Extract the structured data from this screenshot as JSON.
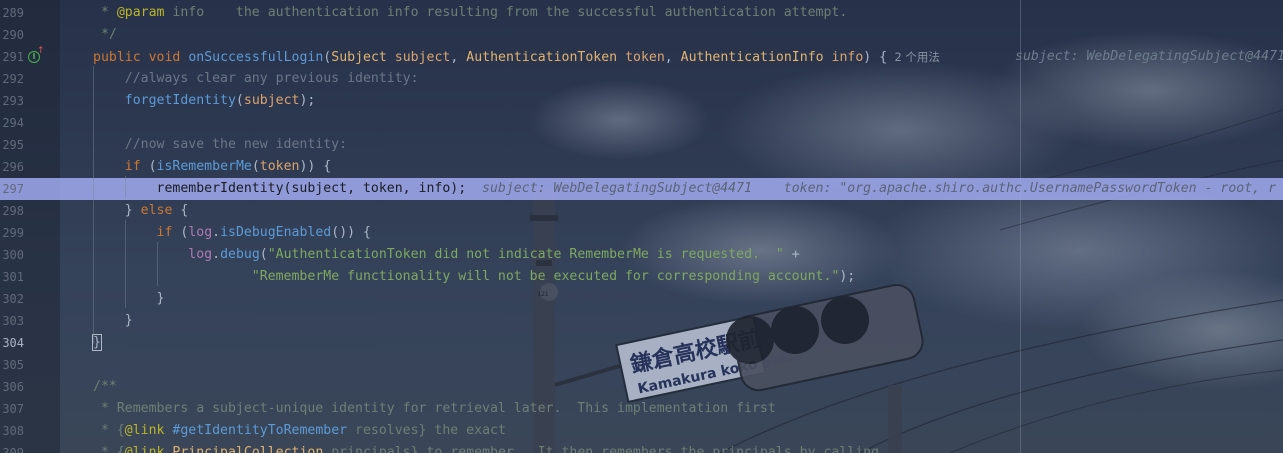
{
  "editor": {
    "usages_hint": "2 个用法",
    "header_inlay": "subject: WebDelegatingSubject@4471",
    "current_line": "304",
    "lines": [
      {
        "num": "289",
        "tokens": [
          {
            "t": " * ",
            "c": "t-doc"
          },
          {
            "t": "@param",
            "c": "t-ann"
          },
          {
            "t": " info",
            "c": "t-doc"
          },
          {
            "t": "    the authentication info resulting from the successful authentication attempt.",
            "c": "t-doc"
          }
        ]
      },
      {
        "num": "290",
        "tokens": [
          {
            "t": " */",
            "c": "t-doc"
          }
        ]
      },
      {
        "num": "291",
        "tokens": [
          {
            "t": "public",
            "c": "t-kw"
          },
          {
            "t": " ",
            "c": "t-plain"
          },
          {
            "t": "void",
            "c": "t-kw"
          },
          {
            "t": " ",
            "c": "t-plain"
          },
          {
            "t": "onSuccessfulLogin",
            "c": "t-fncall"
          },
          {
            "t": "(",
            "c": "t-plain"
          },
          {
            "t": "Subject",
            "c": "t-cls"
          },
          {
            "t": " ",
            "c": "t-plain"
          },
          {
            "t": "subject",
            "c": "t-param"
          },
          {
            "t": ", ",
            "c": "t-plain"
          },
          {
            "t": "AuthenticationToken",
            "c": "t-cls"
          },
          {
            "t": " ",
            "c": "t-plain"
          },
          {
            "t": "token",
            "c": "t-param"
          },
          {
            "t": ", ",
            "c": "t-plain"
          },
          {
            "t": "AuthenticationInfo",
            "c": "t-cls"
          },
          {
            "t": " ",
            "c": "t-plain"
          },
          {
            "t": "info",
            "c": "t-param"
          },
          {
            "t": ") ",
            "c": "t-plain"
          },
          {
            "t": "{",
            "c": "t-plain"
          }
        ]
      },
      {
        "num": "292",
        "tokens": [
          {
            "t": "    //always clear any previous identity:",
            "c": "t-cmt"
          }
        ]
      },
      {
        "num": "293",
        "tokens": [
          {
            "t": "    ",
            "c": "t-plain"
          },
          {
            "t": "forgetIdentity",
            "c": "t-fncall"
          },
          {
            "t": "(",
            "c": "t-plain"
          },
          {
            "t": "subject",
            "c": "t-param"
          },
          {
            "t": ");",
            "c": "t-plain"
          }
        ]
      },
      {
        "num": "294",
        "tokens": []
      },
      {
        "num": "295",
        "tokens": [
          {
            "t": "    //now save the new identity:",
            "c": "t-cmt"
          }
        ]
      },
      {
        "num": "296",
        "tokens": [
          {
            "t": "    ",
            "c": "t-plain"
          },
          {
            "t": "if",
            "c": "t-kw"
          },
          {
            "t": " (",
            "c": "t-plain"
          },
          {
            "t": "isRememberMe",
            "c": "t-fncall"
          },
          {
            "t": "(",
            "c": "t-plain"
          },
          {
            "t": "token",
            "c": "t-param"
          },
          {
            "t": ")) {",
            "c": "t-plain"
          }
        ]
      },
      {
        "num": "297",
        "tokens": [
          {
            "t": "        rememberIdentity(subject, token, info);",
            "c": "t-plain"
          }
        ]
      },
      {
        "num": "298",
        "tokens": [
          {
            "t": "    } ",
            "c": "t-plain"
          },
          {
            "t": "else",
            "c": "t-kw"
          },
          {
            "t": " {",
            "c": "t-plain"
          }
        ]
      },
      {
        "num": "299",
        "tokens": [
          {
            "t": "        ",
            "c": "t-plain"
          },
          {
            "t": "if",
            "c": "t-kw"
          },
          {
            "t": " (",
            "c": "t-plain"
          },
          {
            "t": "log",
            "c": "t-field"
          },
          {
            "t": ".",
            "c": "t-plain"
          },
          {
            "t": "isDebugEnabled",
            "c": "t-fncall"
          },
          {
            "t": "()) {",
            "c": "t-plain"
          }
        ]
      },
      {
        "num": "300",
        "tokens": [
          {
            "t": "            ",
            "c": "t-plain"
          },
          {
            "t": "log",
            "c": "t-field"
          },
          {
            "t": ".",
            "c": "t-plain"
          },
          {
            "t": "debug",
            "c": "t-fncall"
          },
          {
            "t": "(",
            "c": "t-plain"
          },
          {
            "t": "\"AuthenticationToken did not indicate RememberMe is requested.  \"",
            "c": "t-str"
          },
          {
            "t": " +",
            "c": "t-plain"
          }
        ]
      },
      {
        "num": "301",
        "tokens": [
          {
            "t": "                    ",
            "c": "t-plain"
          },
          {
            "t": "\"RememberMe functionality will not be executed for corresponding account.\"",
            "c": "t-str"
          },
          {
            "t": ");",
            "c": "t-plain"
          }
        ]
      },
      {
        "num": "302",
        "tokens": [
          {
            "t": "        }",
            "c": "t-plain"
          }
        ]
      },
      {
        "num": "303",
        "tokens": [
          {
            "t": "    }",
            "c": "t-plain"
          }
        ]
      },
      {
        "num": "304",
        "tokens": [
          {
            "t": "}",
            "c": "t-plain cursor-box"
          }
        ]
      },
      {
        "num": "305",
        "tokens": []
      },
      {
        "num": "306",
        "tokens": [
          {
            "t": "/**",
            "c": "t-doc"
          }
        ]
      },
      {
        "num": "307",
        "tokens": [
          {
            "t": " * Remembers a subject-unique identity for retrieval later.  This implementation first",
            "c": "t-doc"
          }
        ]
      },
      {
        "num": "308",
        "tokens": [
          {
            "t": " * {",
            "c": "t-doc"
          },
          {
            "t": "@link",
            "c": "t-ann"
          },
          {
            "t": " ",
            "c": "t-doc"
          },
          {
            "t": "#getIdentityToRemember",
            "c": "t-fncall"
          },
          {
            "t": " resolves} the exact",
            "c": "t-doc"
          }
        ]
      },
      {
        "num": "309",
        "tokens": [
          {
            "t": " * {",
            "c": "t-doc"
          },
          {
            "t": "@link",
            "c": "t-ann"
          },
          {
            "t": " ",
            "c": "t-doc"
          },
          {
            "t": "PrincipalCollection",
            "c": "t-cls"
          },
          {
            "t": " principals} to remember.  It then remembers the principals by calling",
            "c": "t-doc"
          }
        ]
      }
    ],
    "debug_inlay": {
      "subject": "subject: WebDelegatingSubject@4471",
      "token": "token: \"org.apache.shiro.authc.UsernamePasswordToken - root, r"
    },
    "wallpaper": {
      "sign_kanji": "鎌倉高校駅前",
      "sign_romaji": "Kamakura koko Sta.",
      "pole_tag": "121"
    }
  }
}
